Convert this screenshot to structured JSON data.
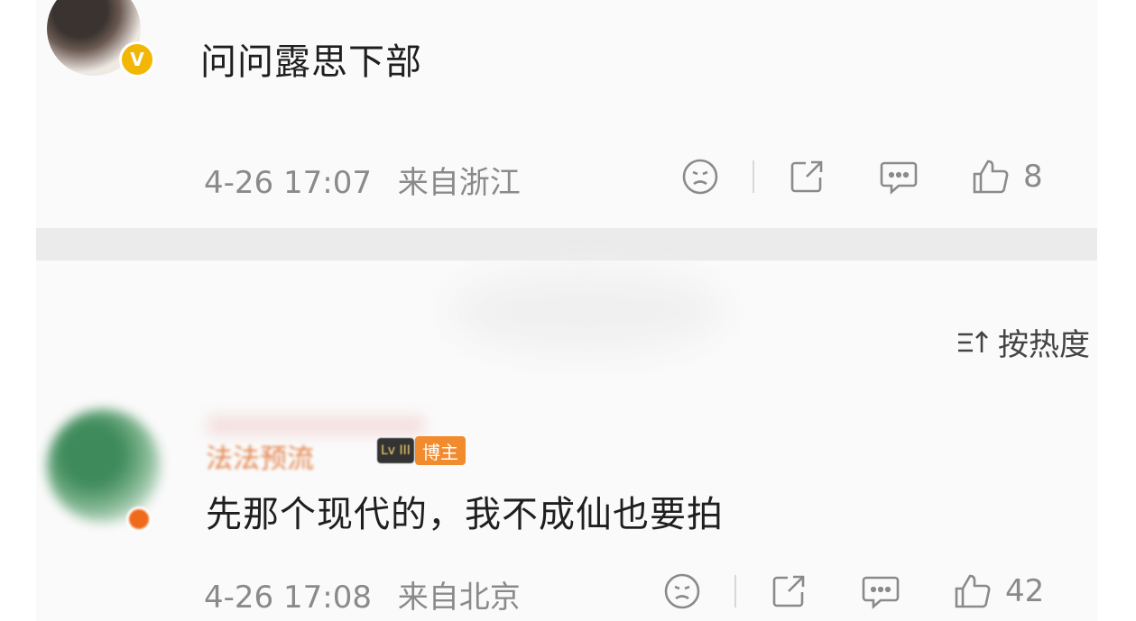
{
  "comments": [
    {
      "text": "问问露思下部",
      "time": "4-26 17:07",
      "location": "来自浙江",
      "likes": "8",
      "icons": [
        "neutral-face-icon",
        "share-icon",
        "comment-icon",
        "thumbs-up-icon"
      ]
    },
    {
      "username": "法法预流",
      "level_badge": "Lv III",
      "host_badge": "博主",
      "text": "先那个现代的，我不成仙也要拍",
      "time": "4-26 17:08",
      "location": "来自北京",
      "likes": "42",
      "icons": [
        "neutral-face-icon",
        "share-icon",
        "comment-icon",
        "thumbs-up-icon"
      ]
    }
  ],
  "sort": {
    "label": "按热度",
    "icon": "sort-icon"
  },
  "colors": {
    "accent": "#f2b705",
    "host": "#f28a2e",
    "meta": "#8a8a8a",
    "band": "#ebebeb"
  }
}
